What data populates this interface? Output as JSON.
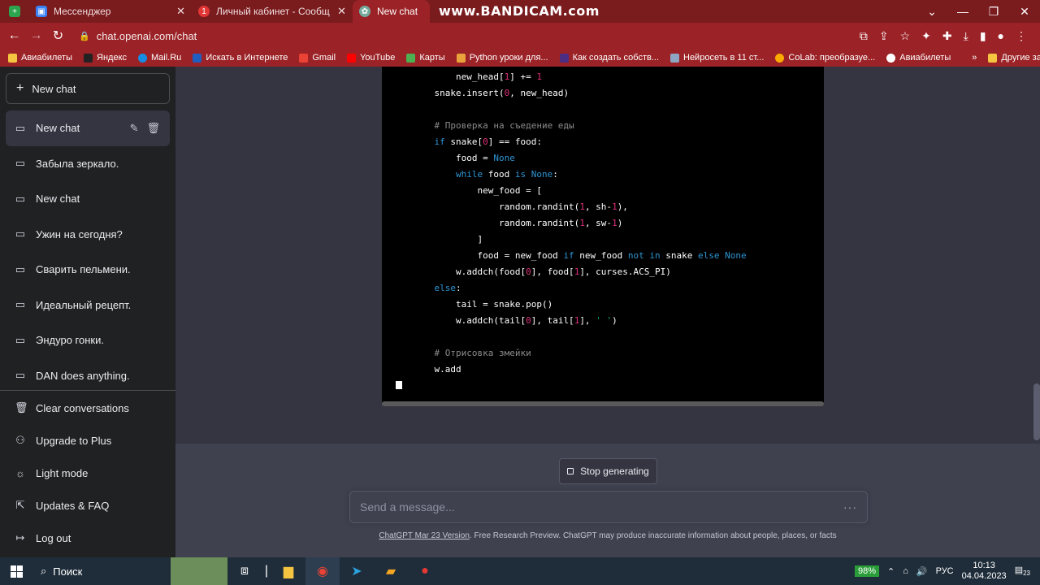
{
  "browser": {
    "tabs": [
      {
        "label": "Мессенджер",
        "active": false,
        "icon": "messenger-icon",
        "color": "#3b82f6"
      },
      {
        "label": "Личный кабинет - Сообщения",
        "active": false,
        "icon": "notification-icon",
        "color": "#e23636",
        "badge": "1"
      },
      {
        "label": "New chat",
        "active": true,
        "icon": "chatgpt-icon",
        "color": "#74aa9c"
      }
    ],
    "watermark": "www.BANDICAM.com",
    "url": "chat.openai.com/chat",
    "bookmarks": [
      "Авиабилеты",
      "Яндекс",
      "Mail.Ru",
      "Искать в Интернете",
      "Gmail",
      "YouTube",
      "Карты",
      "Python уроки для...",
      "Как создать собств...",
      "Нейросеть в 11 ст...",
      "CoLab: преобразуе...",
      "Авиабилеты"
    ],
    "bookmarks_more": "»",
    "other_bookmarks": "Другие закладки"
  },
  "sidebar": {
    "new_chat": "New chat",
    "chats": [
      "New chat",
      "Забыла зеркало.",
      "New chat",
      "Ужин на сегодня?",
      "Сварить пельмени.",
      "Идеальный рецепт.",
      "Эндуро гонки.",
      "DAN does anything."
    ],
    "bottom": [
      "Clear conversations",
      "Upgrade to Plus",
      "Light mode",
      "Updates & FAQ",
      "Log out"
    ]
  },
  "code_lines": [
    [
      {
        "t": "        new_head["
      },
      {
        "t": "1",
        "c": "num"
      },
      {
        "t": "] += "
      },
      {
        "t": "1",
        "c": "num"
      }
    ],
    [
      {
        "t": "    snake.insert("
      },
      {
        "t": "0",
        "c": "num"
      },
      {
        "t": ", new_head)"
      }
    ],
    [
      {
        "t": ""
      }
    ],
    [
      {
        "t": "    # Проверка на съедение еды",
        "c": "com"
      }
    ],
    [
      {
        "t": "    "
      },
      {
        "t": "if",
        "c": "kw"
      },
      {
        "t": " snake["
      },
      {
        "t": "0",
        "c": "num"
      },
      {
        "t": "] == food:"
      }
    ],
    [
      {
        "t": "        food = "
      },
      {
        "t": "None",
        "c": "kw"
      }
    ],
    [
      {
        "t": "        "
      },
      {
        "t": "while",
        "c": "kw"
      },
      {
        "t": " food "
      },
      {
        "t": "is",
        "c": "kw"
      },
      {
        "t": " "
      },
      {
        "t": "None",
        "c": "kw"
      },
      {
        "t": ":"
      }
    ],
    [
      {
        "t": "            new_food = ["
      }
    ],
    [
      {
        "t": "                random.randint("
      },
      {
        "t": "1",
        "c": "num"
      },
      {
        "t": ", sh-"
      },
      {
        "t": "1",
        "c": "num"
      },
      {
        "t": "),"
      }
    ],
    [
      {
        "t": "                random.randint("
      },
      {
        "t": "1",
        "c": "num"
      },
      {
        "t": ", sw-"
      },
      {
        "t": "1",
        "c": "num"
      },
      {
        "t": ")"
      }
    ],
    [
      {
        "t": "            ]"
      }
    ],
    [
      {
        "t": "            food = new_food "
      },
      {
        "t": "if",
        "c": "kw"
      },
      {
        "t": " new_food "
      },
      {
        "t": "not",
        "c": "kw"
      },
      {
        "t": " "
      },
      {
        "t": "in",
        "c": "kw"
      },
      {
        "t": " snake "
      },
      {
        "t": "else",
        "c": "kw"
      },
      {
        "t": " "
      },
      {
        "t": "None",
        "c": "kw"
      }
    ],
    [
      {
        "t": "        w.addch(food["
      },
      {
        "t": "0",
        "c": "num"
      },
      {
        "t": "], food["
      },
      {
        "t": "1",
        "c": "num"
      },
      {
        "t": "], curses.ACS_PI)"
      }
    ],
    [
      {
        "t": "    "
      },
      {
        "t": "else",
        "c": "kw"
      },
      {
        "t": ":"
      }
    ],
    [
      {
        "t": "        tail = snake.pop()"
      }
    ],
    [
      {
        "t": "        w.addch(tail["
      },
      {
        "t": "0",
        "c": "num"
      },
      {
        "t": "], tail["
      },
      {
        "t": "1",
        "c": "num"
      },
      {
        "t": "], "
      },
      {
        "t": "' '",
        "c": "str"
      },
      {
        "t": ")"
      }
    ],
    [
      {
        "t": ""
      }
    ],
    [
      {
        "t": "    # Отрисовка змейки",
        "c": "com"
      }
    ],
    [
      {
        "t": "    w.add"
      }
    ]
  ],
  "stop_button": "Stop generating",
  "message_placeholder": "Send a message...",
  "footer_link": "ChatGPT Mar 23 Version",
  "footer_text": ". Free Research Preview. ChatGPT may produce inaccurate information about people, places, or facts",
  "taskbar": {
    "search": "Поиск",
    "battery": "98%",
    "lang": "РУС",
    "time": "10:13",
    "date": "04.04.2023",
    "notif_count": "23"
  }
}
